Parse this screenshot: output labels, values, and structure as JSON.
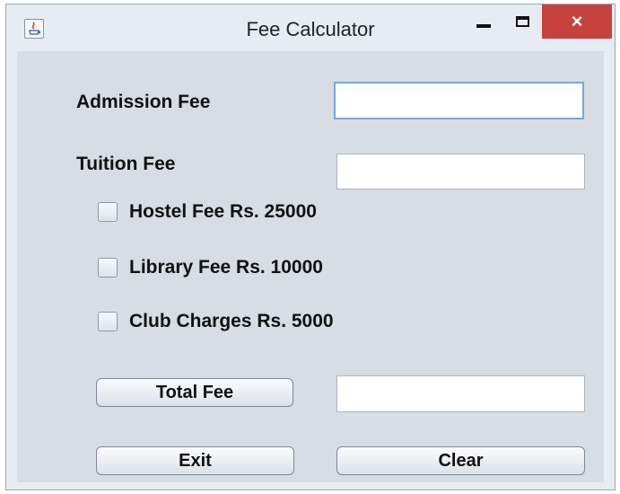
{
  "window": {
    "title": "Fee Calculator",
    "close_symbol": "×",
    "icons": {
      "app": "java-app-icon",
      "minimize": "minimize-icon",
      "maximize": "maximize-icon",
      "close": "close-icon"
    }
  },
  "form": {
    "admission_label": "Admission Fee",
    "admission_value": "",
    "tuition_label": "Tuition Fee",
    "tuition_value": "",
    "hostel_label": "Hostel Fee Rs. 25000",
    "hostel_checked": false,
    "library_label": "Library Fee Rs. 10000",
    "library_checked": false,
    "club_label": "Club Charges Rs. 5000",
    "club_checked": false,
    "total_button": "Total Fee",
    "total_value": "",
    "exit_button": "Exit",
    "clear_button": "Clear"
  },
  "colors": {
    "close_button": "#c7423b",
    "panel": "#d8dce3",
    "focus_border": "#7aa7d6"
  }
}
